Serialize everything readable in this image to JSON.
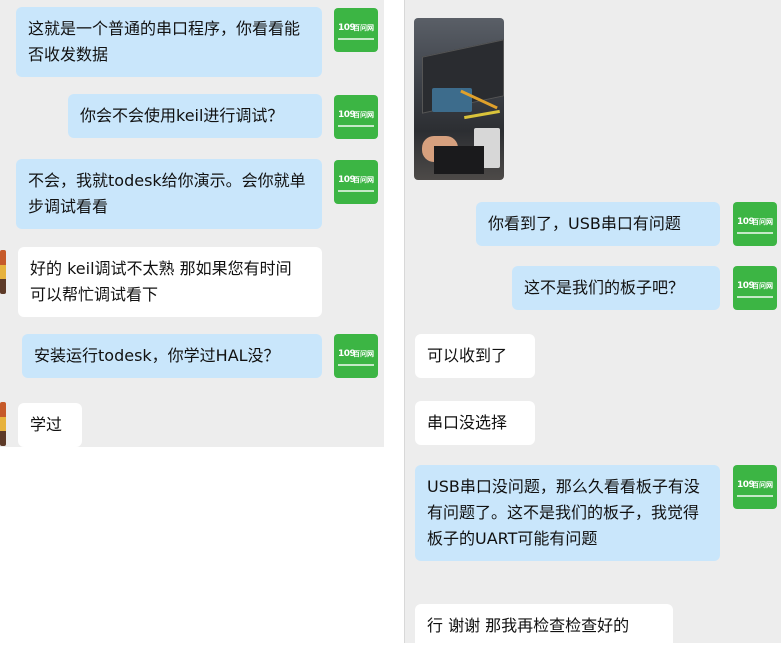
{
  "left_chat": {
    "messages": [
      {
        "sender": "me",
        "text": "这就是一个普通的串口程序，你看看能否收发数据"
      },
      {
        "sender": "me",
        "text": "你会不会使用keil进行调试？"
      },
      {
        "sender": "me",
        "text": "不会，我就todesk给你演示。会你就单步调试看看"
      },
      {
        "sender": "them",
        "text": "好的 keil调试不太熟  那如果您有时间 可以帮忙调试看下"
      },
      {
        "sender": "me",
        "text": "安装运行todesk，你学过HAL没？"
      },
      {
        "sender": "them",
        "text": "学过"
      }
    ]
  },
  "right_chat": {
    "messages": [
      {
        "sender": "them",
        "type": "image"
      },
      {
        "sender": "me",
        "text": "你看到了，USB串口有问题"
      },
      {
        "sender": "me",
        "text": "这不是我们的板子吧？"
      },
      {
        "sender": "them",
        "text": "可以收到了"
      },
      {
        "sender": "them",
        "text": "串口没选择"
      },
      {
        "sender": "me",
        "text": "USB串口没问题，那么久看看板子有没有问题了。这不是我们的板子，我觉得板子的UART可能有问题"
      },
      {
        "sender": "them",
        "text": "行 谢谢 那我再检查检查好的"
      }
    ]
  },
  "avatar": {
    "logo_number": "109",
    "logo_text": "百问网"
  },
  "colors": {
    "my_bubble": "#c9e6fb",
    "their_bubble": "#ffffff",
    "logo_green": "#3cb544",
    "background": "#ededed"
  }
}
